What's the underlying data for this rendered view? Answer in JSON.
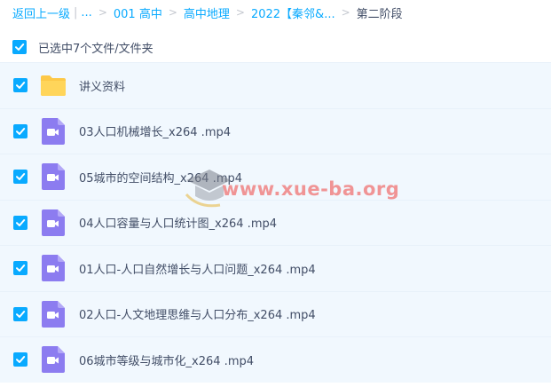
{
  "breadcrumb": {
    "back": "返回上一级",
    "ellipsis": "...",
    "items": [
      "001 高中",
      "高中地理",
      "2022【秦邻&..."
    ],
    "current": "第二阶段"
  },
  "selection": {
    "label": "已选中7个文件/文件夹"
  },
  "files": [
    {
      "name": "讲义资料",
      "icon": "folder-icon"
    },
    {
      "name": "03人口机械增长_x264 .mp4",
      "icon": "video-file-icon"
    },
    {
      "name": "05城市的空间结构_x264 .mp4",
      "icon": "video-file-icon"
    },
    {
      "name": "04人口容量与人口统计图_x264 .mp4",
      "icon": "video-file-icon"
    },
    {
      "name": "01人口-人口自然增长与人口问题_x264 .mp4",
      "icon": "video-file-icon"
    },
    {
      "name": "02人口-人文地理思维与人口分布_x264 .mp4",
      "icon": "video-file-icon"
    },
    {
      "name": "06城市等级与城市化_x264 .mp4",
      "icon": "video-file-icon"
    }
  ],
  "watermark": {
    "text": "www.xue-ba.org"
  },
  "colors": {
    "accent": "#09aaff",
    "row_selected_bg": "#f1f8fe",
    "folder": "#fdc847",
    "video_icon": "#8c7cf0",
    "watermark": "#f08383"
  }
}
